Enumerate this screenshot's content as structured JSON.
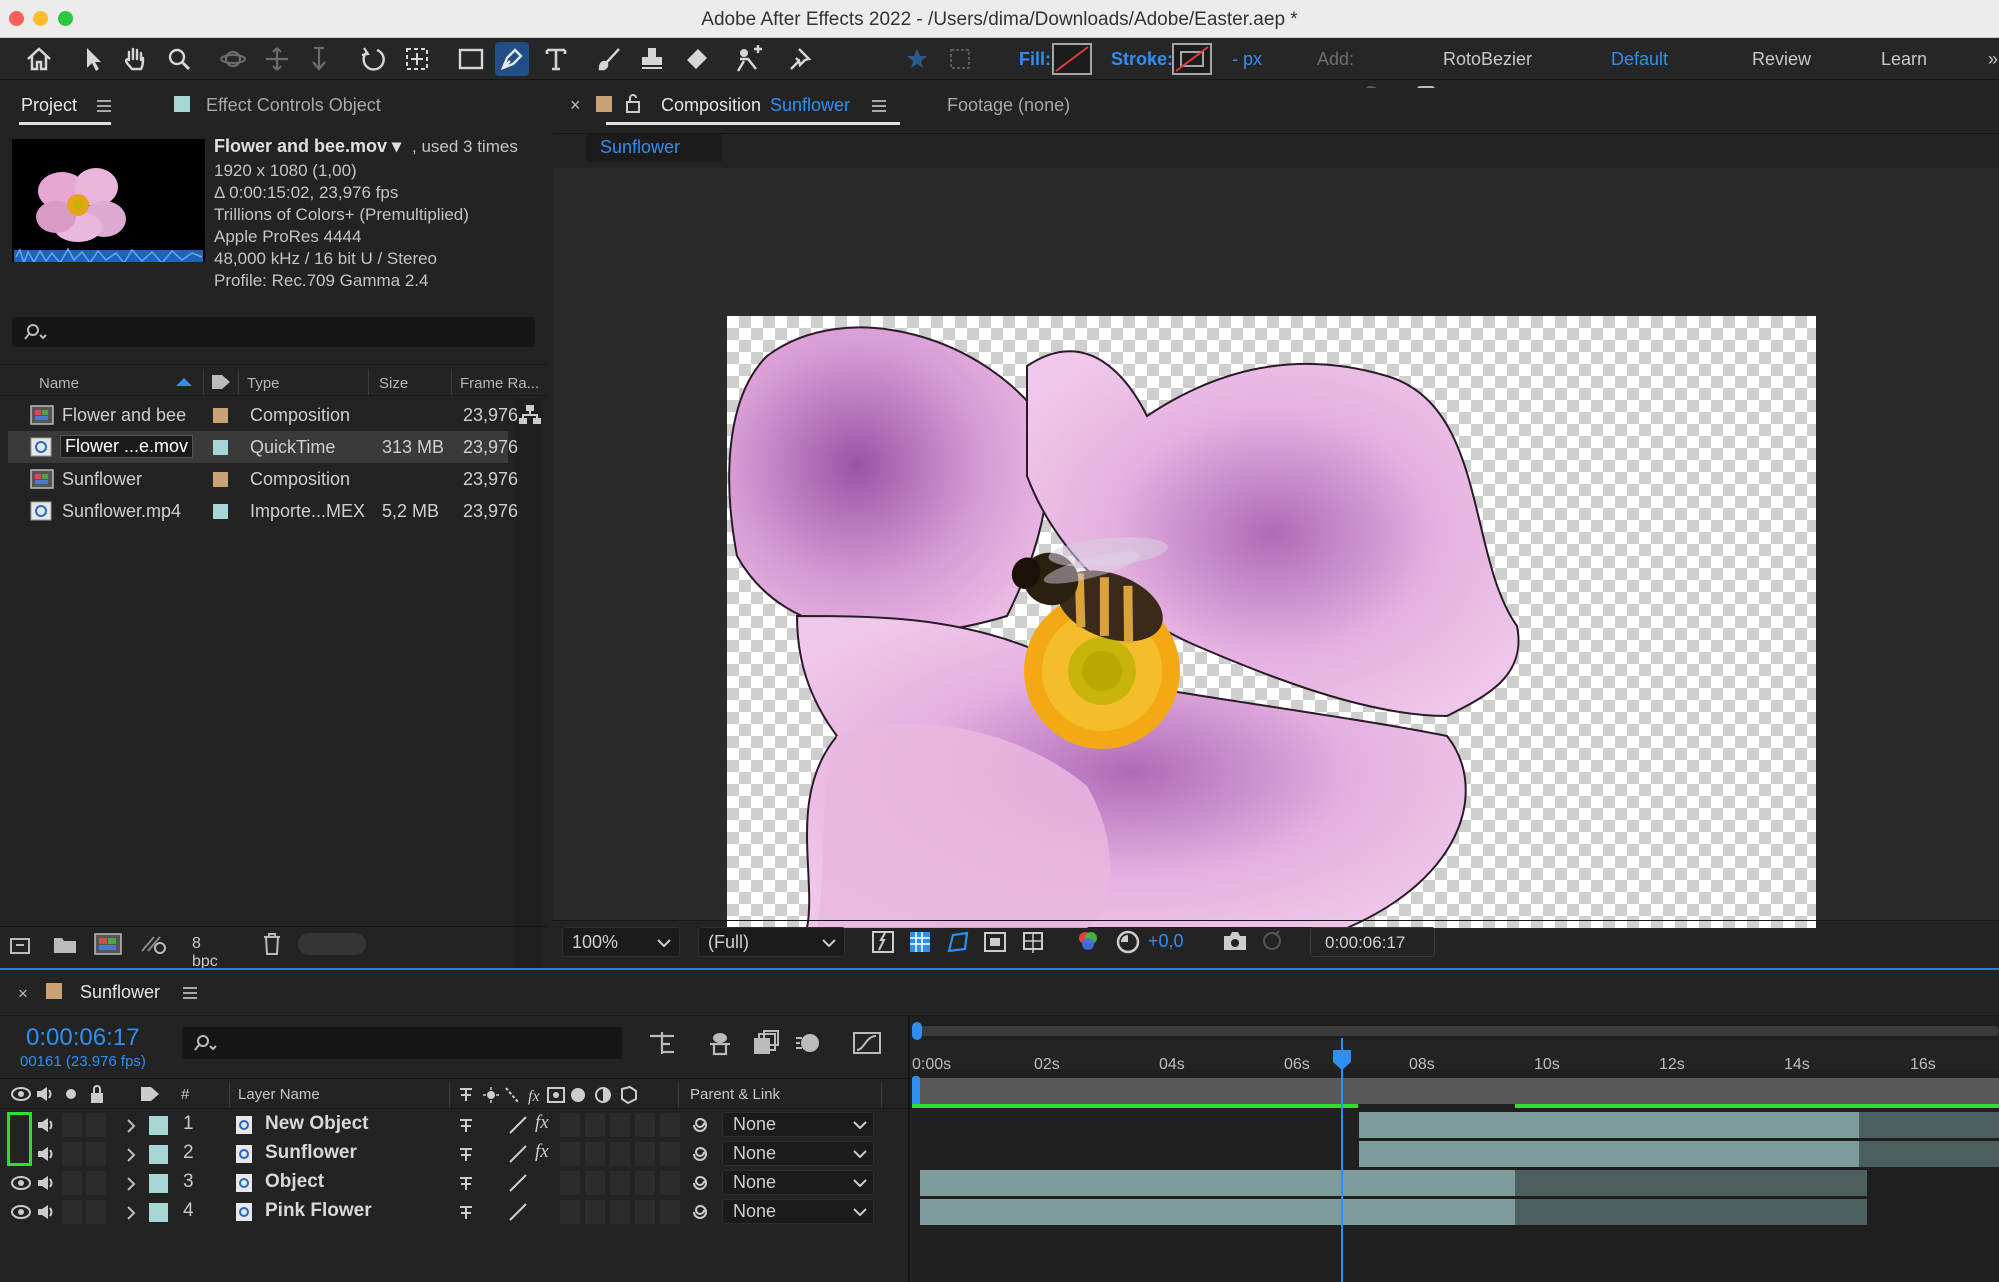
{
  "window": {
    "title": "Adobe After Effects 2022 - /Users/dima/Downloads/Adobe/Easter.aep *"
  },
  "toolbar": {
    "tools": [
      "home-icon",
      "selection-icon",
      "hand-icon",
      "zoom-icon",
      "orbit-icon",
      "pan-icon",
      "dolly-icon",
      "rotate-icon",
      "anchor-icon",
      "rectangle-icon",
      "pen-icon",
      "type-icon",
      "brush-icon",
      "clone-stamp-icon",
      "eraser-icon",
      "roto-brush-icon",
      "puppet-pin-icon"
    ],
    "fill_label": "Fill:",
    "stroke_label": "Stroke:",
    "stroke_width": "- px",
    "add_label": "Add:",
    "rotobezier_label": "RotoBezier",
    "workspaces": [
      "Default",
      "Review",
      "Learn"
    ],
    "close_glyph": "»"
  },
  "project": {
    "tab_project": "Project",
    "tab_effect_controls": "Effect Controls Object",
    "item_name": "Flower and bee.mov ▾",
    "item_used": ", used 3 times",
    "info": [
      "1920 x 1080 (1,00)",
      "Δ 0:00:15:02, 23,976 fps",
      "Trillions of Colors+ (Premultiplied)",
      "Apple ProRes 4444",
      "48,000 kHz / 16 bit U / Stereo",
      "Profile: Rec.709 Gamma 2.4"
    ],
    "columns": [
      "Name",
      "Type",
      "Size",
      "Frame Ra..."
    ],
    "items": [
      {
        "name": "Flower and bee",
        "type": "Composition",
        "size": "",
        "fps": "23,976",
        "label_color": "#c9a376"
      },
      {
        "name": "Flower ...e.mov",
        "type": "QuickTime",
        "size": "313 MB",
        "fps": "23,976",
        "label_color": "#a6d6d4"
      },
      {
        "name": "Sunflower",
        "type": "Composition",
        "size": "",
        "fps": "23,976",
        "label_color": "#c9a376"
      },
      {
        "name": "Sunflower.mp4",
        "type": "Importe...MEX",
        "size": "5,2 MB",
        "fps": "23,976",
        "label_color": "#a6d6d4"
      }
    ],
    "bpc": "8 bpc"
  },
  "composition": {
    "tab_prefix": "Composition",
    "tab_name": "Sunflower",
    "footage_tab": "Footage (none)",
    "breadcrumb": "Sunflower",
    "zoom": "100%",
    "resolution": "(Full)",
    "exposure": "+0,0",
    "timecode": "0:00:06:17"
  },
  "timeline": {
    "tab_name": "Sunflower",
    "current_time": "0:00:06:17",
    "frame_info": "00161 (23.976 fps)",
    "col_number": "#",
    "col_layer_name": "Layer Name",
    "col_parent": "Parent & Link",
    "ruler": [
      "0:00s",
      "02s",
      "04s",
      "06s",
      "08s",
      "10s",
      "12s",
      "14s",
      "16s"
    ],
    "layers": [
      {
        "num": "1",
        "name": "New Object",
        "parent": "None",
        "fx": true
      },
      {
        "num": "2",
        "name": "Sunflower",
        "parent": "None",
        "fx": true
      },
      {
        "num": "3",
        "name": "Object",
        "parent": "None",
        "fx": false
      },
      {
        "num": "4",
        "name": "Pink Flower",
        "parent": "None",
        "fx": false
      }
    ],
    "accent": "#2f8ff0"
  }
}
